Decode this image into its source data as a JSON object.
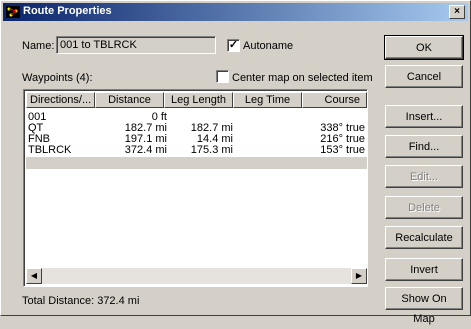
{
  "window": {
    "title": "Route Properties",
    "close_glyph": "×"
  },
  "form": {
    "name_label": "Name:",
    "name_value": "001 to TBLRCK",
    "autoname_label": "Autoname",
    "autoname_checked": "✓",
    "waypoints_label": "Waypoints (4):",
    "center_map_label": "Center map on selected item"
  },
  "table": {
    "headers": [
      "Directions/...",
      "Distance",
      "Leg Length",
      "Leg Time",
      "Course"
    ],
    "rows": [
      {
        "name": "001",
        "distance": "0 ft",
        "leg_length": "",
        "leg_time": "",
        "course": ""
      },
      {
        "name": "QT",
        "distance": "182.7 mi",
        "leg_length": "182.7 mi",
        "leg_time": "",
        "course": "338° true"
      },
      {
        "name": "FNB",
        "distance": "197.1 mi",
        "leg_length": "14.4 mi",
        "leg_time": "",
        "course": "216° true"
      },
      {
        "name": "TBLRCK",
        "distance": "372.4 mi",
        "leg_length": "175.3 mi",
        "leg_time": "",
        "course": "153° true"
      }
    ]
  },
  "scrollbar": {
    "left_glyph": "◀",
    "right_glyph": "▶"
  },
  "total_distance": "Total Distance: 372.4 mi",
  "buttons": {
    "ok": "OK",
    "cancel": "Cancel",
    "insert": "Insert...",
    "find": "Find...",
    "edit": "Edit...",
    "delete": "Delete",
    "recalculate": "Recalculate",
    "invert": "Invert",
    "show_on_map": "Show On Map"
  },
  "colors": {
    "titlebar_start": "#0a246a",
    "titlebar_end": "#a6caf0",
    "face": "#d4d0c8"
  }
}
